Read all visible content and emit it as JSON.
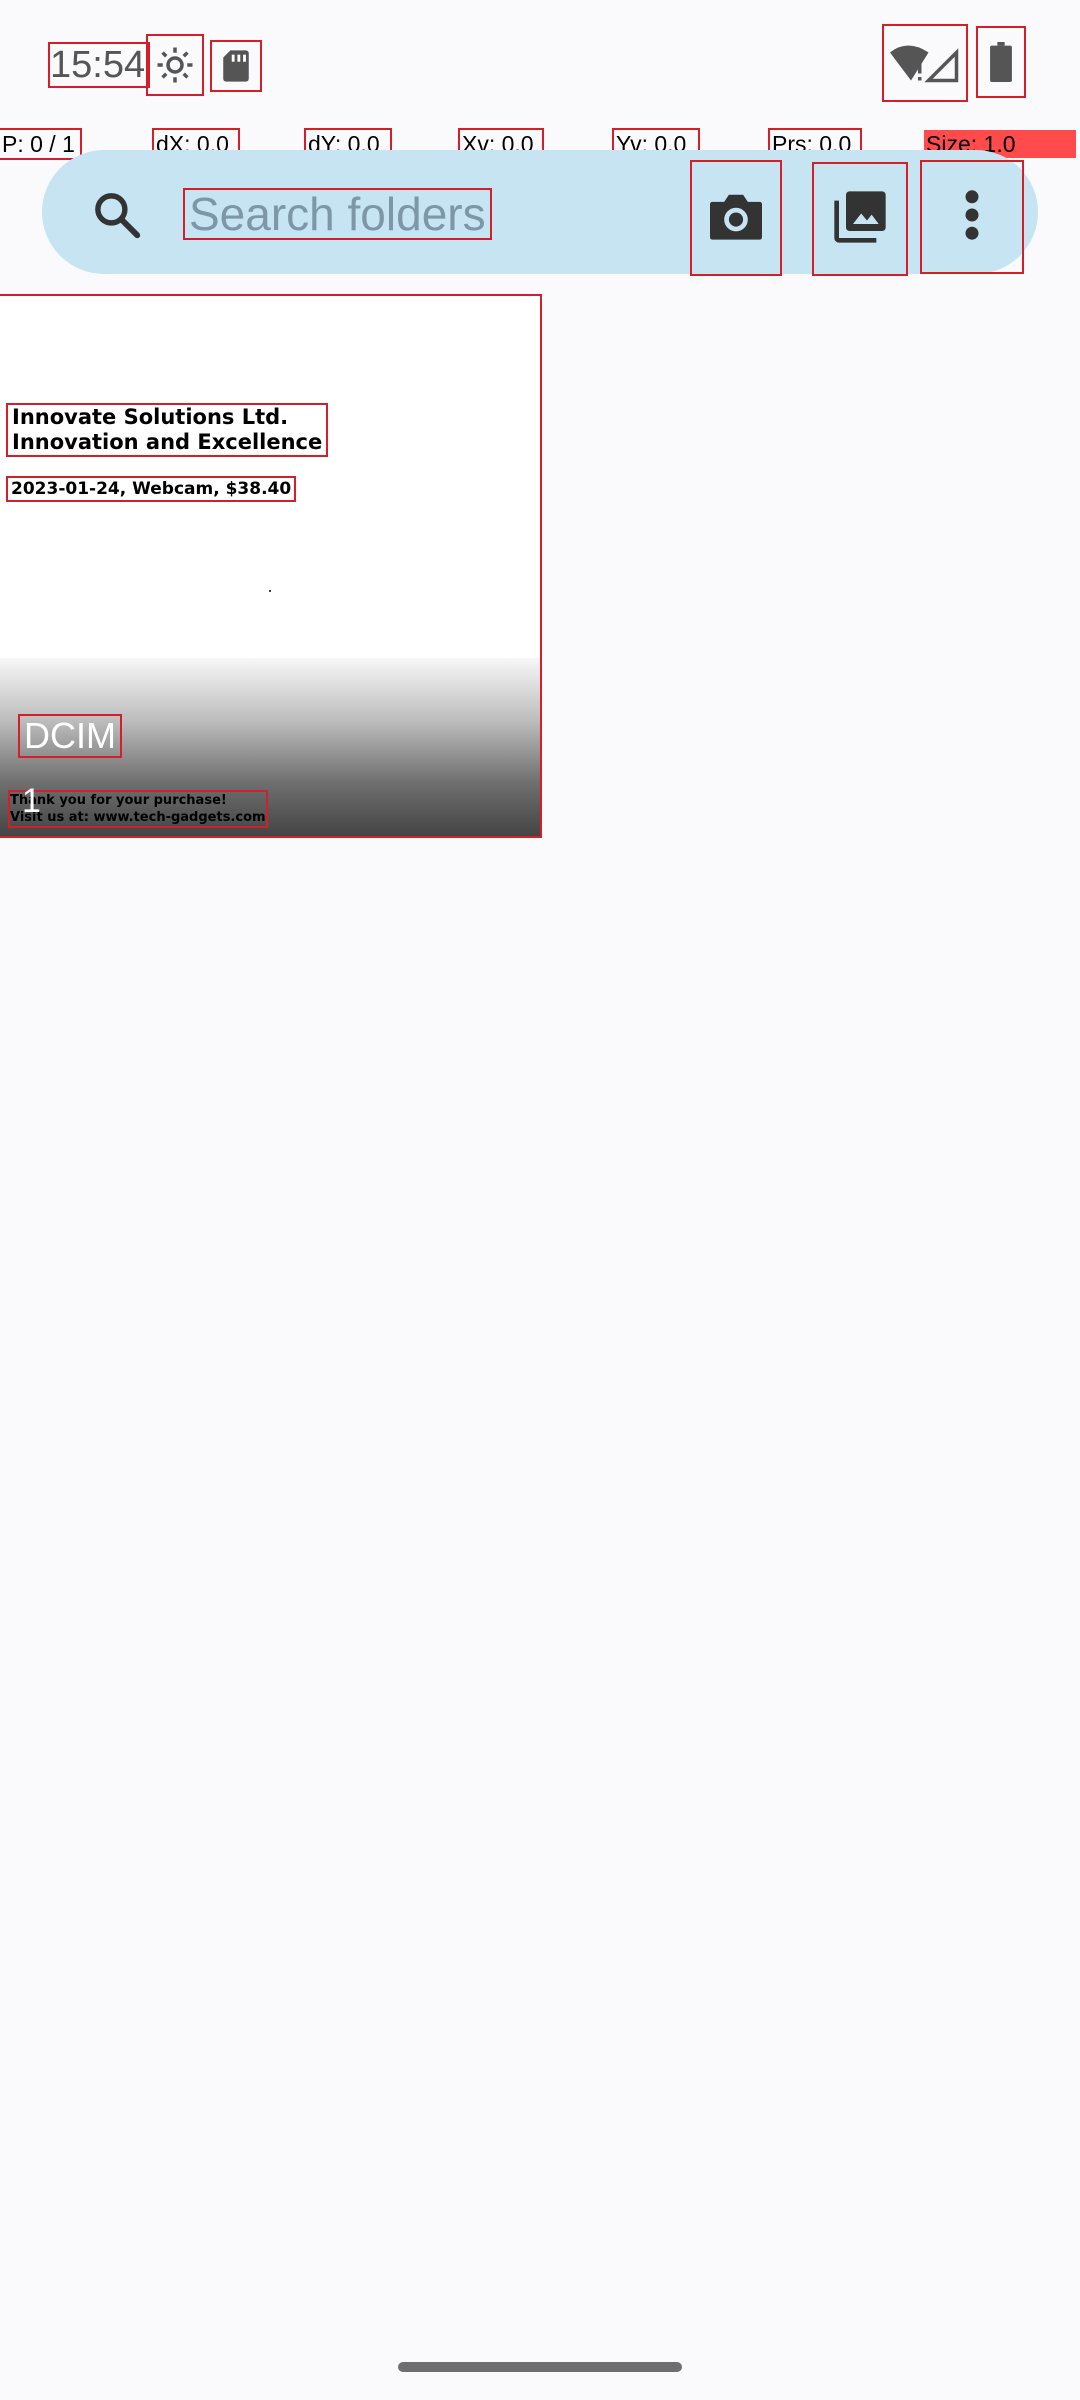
{
  "status_bar": {
    "time": "15:54",
    "icons": [
      "settings-gear-icon",
      "sd-card-icon",
      "wifi-alert-icon",
      "cell-signal-icon",
      "battery-icon"
    ]
  },
  "pointer_debug": {
    "p": "P: 0 / 1",
    "dx": "dX: 0.0",
    "dy": "dY: 0.0",
    "xv": "Xv: 0.0",
    "yv": "Yv: 0.0",
    "prs": "Prs: 0.0",
    "size": "Size: 1.0"
  },
  "search": {
    "placeholder": "Search folders",
    "icons": [
      "search-icon",
      "camera-icon",
      "photo-library-icon",
      "more-vert-icon"
    ]
  },
  "folders": [
    {
      "name": "DCIM",
      "count": "1",
      "thumbnail": {
        "title_line1": "Innovate Solutions Ltd.",
        "title_line2": "Innovation and Excellence",
        "date_line": "2023-01-24, Webcam, $38.40",
        "footer_line1": "Thank you for your purchase!",
        "footer_line2": "Visit us at: www.tech-gadgets.com"
      }
    }
  ],
  "colors": {
    "background": "#fafafd",
    "search_bar": "#c7e4f2",
    "size_highlight": "#ff4b4b"
  }
}
